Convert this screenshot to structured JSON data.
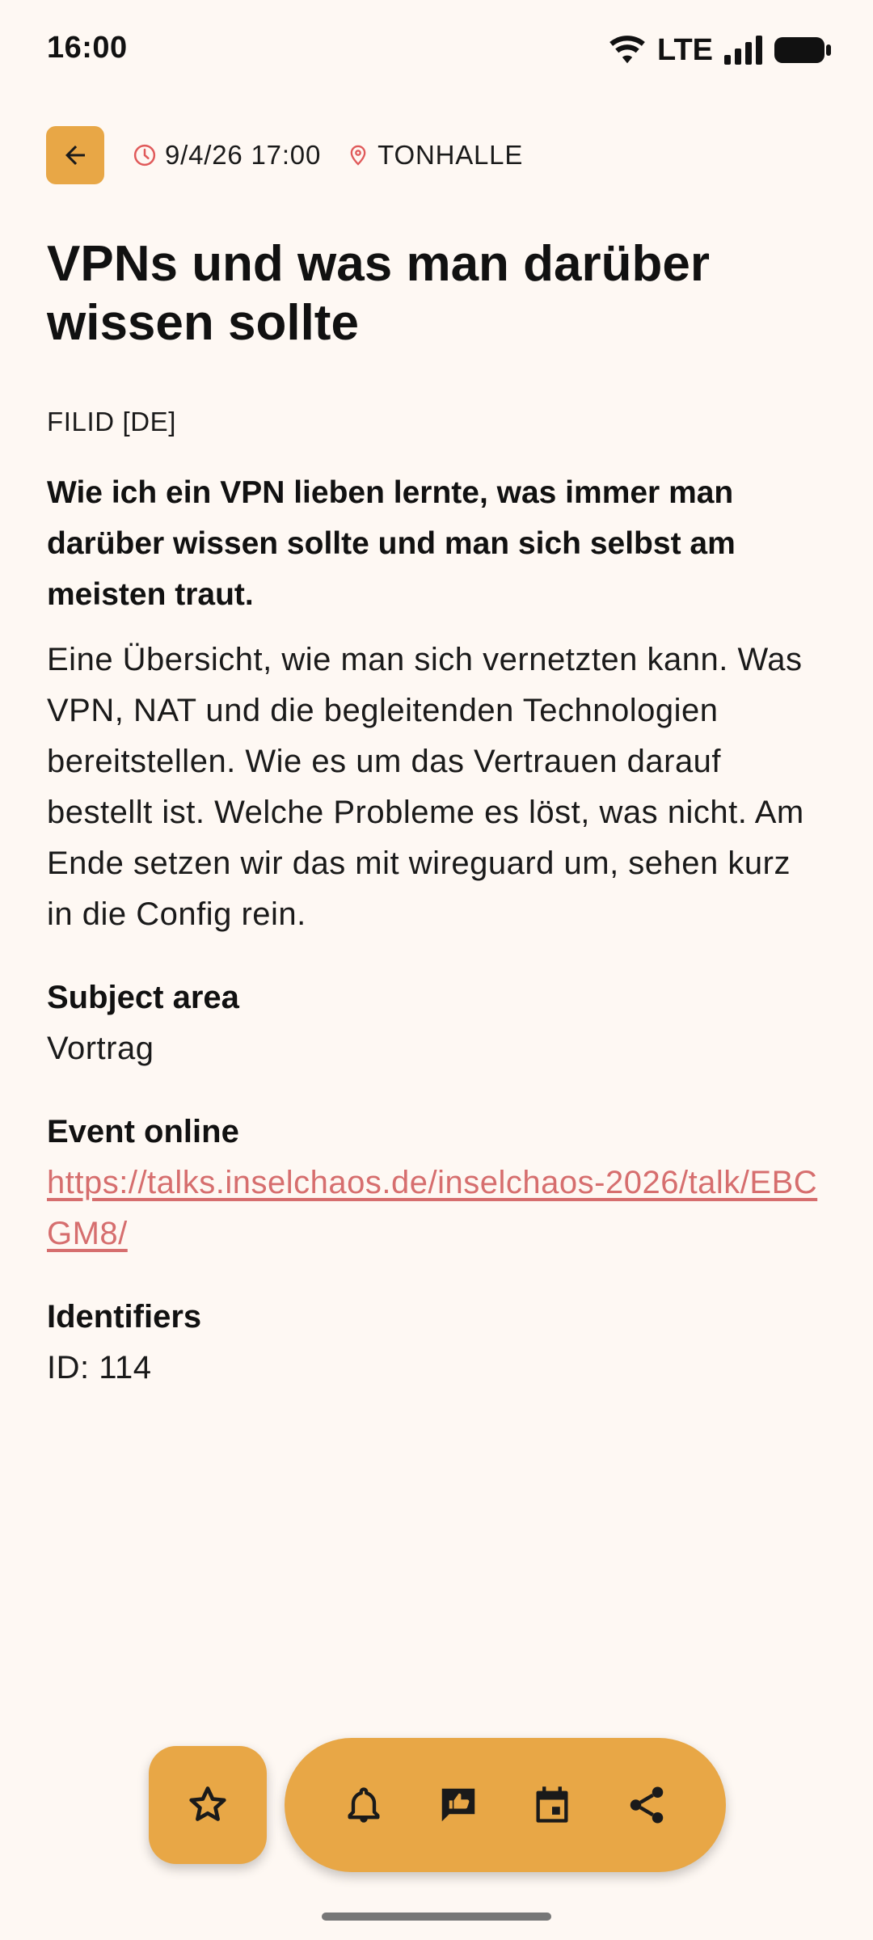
{
  "status_bar": {
    "time": "16:00",
    "network": "LTE"
  },
  "header": {
    "datetime": "9/4/26 17:00",
    "location": "TONHALLE"
  },
  "event": {
    "title": "VPNs und was man darüber wissen sollte",
    "speaker": "FILID [DE]",
    "subtitle": "Wie ich ein VPN lieben lernte, was immer man darüber wissen sollte und man sich selbst am meisten traut.",
    "abstract": "Eine Übersicht, wie man sich vernetzten kann. Was VPN, NAT und die begleitenden Technologien bereitstellen. Wie es um das Vertrauen darauf bestellt ist. Welche Probleme es löst, was nicht. Am Ende setzen wir das mit wireguard um, sehen kurz in die Config rein."
  },
  "sections": {
    "subject_area_label": "Subject area",
    "subject_area_value": "Vortrag",
    "event_online_label": "Event online",
    "event_online_url": "https://talks.inselchaos.de/inselchaos-2026/talk/EBCGM8/",
    "identifiers_label": "Identifiers",
    "identifiers_value": "ID: 114"
  },
  "icons": {
    "back": "arrow-left-icon",
    "time": "clock-icon",
    "location": "location-pin-icon",
    "favorite": "star-outline-icon",
    "alarm": "bell-icon",
    "feedback": "feedback-thumb-icon",
    "calendar": "calendar-event-icon",
    "share": "share-icon"
  },
  "colors": {
    "accent": "#E8A746",
    "background": "#FEF8F3",
    "link": "#D66E6E",
    "meta_icon": "#E05A5A"
  }
}
